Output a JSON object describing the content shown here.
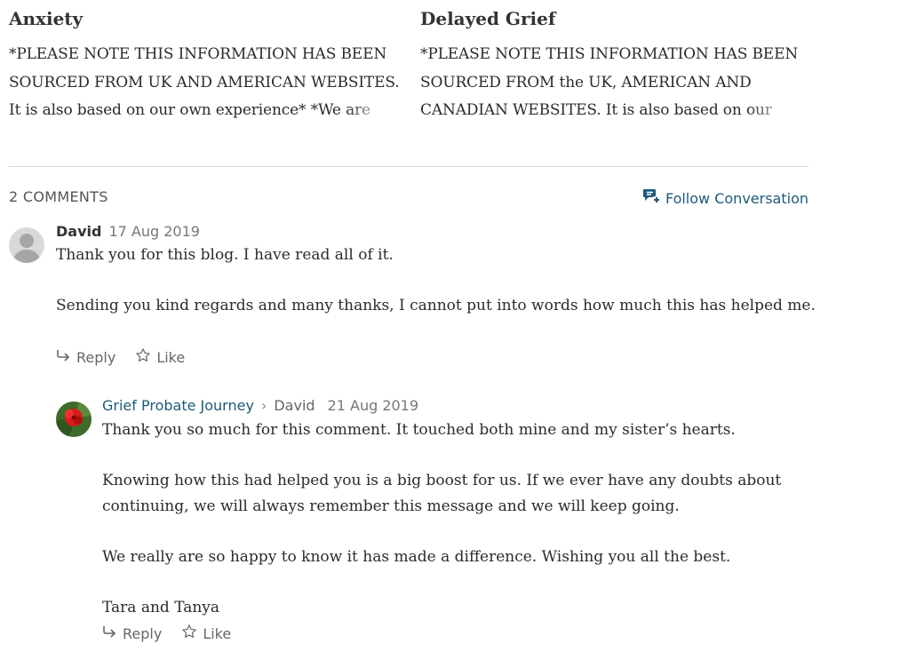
{
  "related_posts": [
    {
      "title": "Anxiety",
      "excerpt": "*PLEASE NOTE THIS INFORMATION HAS BEEN SOURCED FROM UK AND AMERICAN WEBSITES. It is also based on our own experience* *We are"
    },
    {
      "title": "Delayed Grief",
      "excerpt": "*PLEASE NOTE THIS INFORMATION HAS BEEN SOURCED FROM the UK, AMERICAN AND CANADIAN WEBSITES. It is also based on our"
    }
  ],
  "comments_section": {
    "count_label": "2 COMMENTS",
    "follow_label": "Follow Conversation",
    "accent_color": "#1e5a7a"
  },
  "comments": [
    {
      "author": "David",
      "date": "17 Aug 2019",
      "paragraphs": [
        "Thank you for this blog. I have read all of it.",
        "Sending you kind regards and many thanks, I cannot put into words how much this has helped me."
      ],
      "reply_label": "Reply",
      "like_label": "Like"
    },
    {
      "author": "Grief Probate Journey",
      "in_reply_to": "David",
      "date": "21 Aug 2019",
      "paragraphs": [
        "Thank you so much for this comment. It touched both mine and my sister’s hearts.",
        "Knowing how this had helped you is a big boost for us. If we ever have any doubts about continuing, we will always remember this message and we will keep going.",
        "We really are so happy to know it has made a difference. Wishing you all the best.",
        "Tara and Tanya"
      ],
      "reply_label": "Reply",
      "like_label": "Like"
    }
  ],
  "icons": {
    "follow": "comment-plus-icon",
    "reply": "reply-arrow-icon",
    "like": "star-outline-icon",
    "default_avatar": "person-silhouette-icon",
    "author_avatar": "red-flower-avatar"
  }
}
